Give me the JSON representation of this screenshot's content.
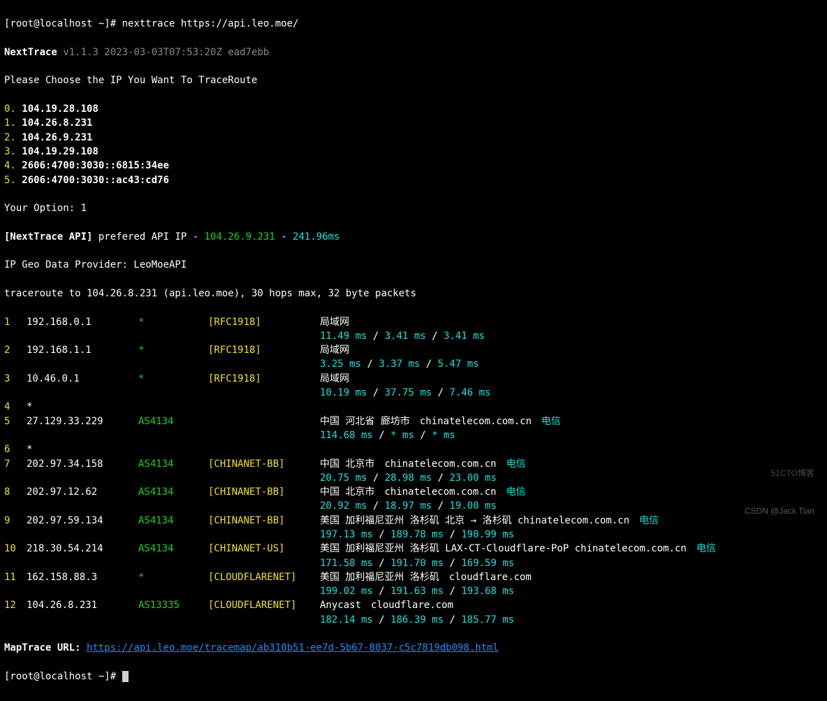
{
  "prompt1_user": "[root@localhost ~]#",
  "cmd": "nexttrace https://api.leo.moe/",
  "app_name": "NextTrace",
  "version": "v1.1.3 2023-03-03T07:53:20Z ead7ebb",
  "choose_msg": "Please Choose the IP You Want To TraceRoute",
  "ip_options": [
    {
      "idx": "0.",
      "ip": "104.19.28.108"
    },
    {
      "idx": "1.",
      "ip": "104.26.8.231"
    },
    {
      "idx": "2.",
      "ip": "104.26.9.231"
    },
    {
      "idx": "3.",
      "ip": "104.19.29.108"
    },
    {
      "idx": "4.",
      "ip": "2606:4700:3030::6815:34ee"
    },
    {
      "idx": "5.",
      "ip": "2606:4700:3030::ac43:cd76"
    }
  ],
  "your_option": "Your Option: ",
  "option_val": "1",
  "api_label": "[NextTrace API]",
  "api_msg": " prefered API IP - ",
  "api_ip": "104.26.9.231",
  "api_sep": " - ",
  "api_ms": "241.96ms",
  "geo_line": "IP Geo Data Provider: LeoMoeAPI",
  "tr_line": "traceroute to 104.26.8.231 (api.leo.moe), 30 hops max, 32 byte packets",
  "hops": [
    {
      "n": "1",
      "ip": "192.168.0.1",
      "as": "*",
      "tag": "[RFC1918]",
      "loc": "局域网",
      "t": [
        "11.49 ms",
        "3.41 ms",
        "3.41 ms"
      ]
    },
    {
      "n": "2",
      "ip": "192.168.1.1",
      "as": "*",
      "tag": "[RFC1918]",
      "loc": "局域网",
      "t": [
        "3.25 ms",
        "3.37 ms",
        "5.47 ms"
      ]
    },
    {
      "n": "3",
      "ip": "10.46.0.1",
      "as": "*",
      "tag": "[RFC1918]",
      "loc": "局域网",
      "t": [
        "10.19 ms",
        "37.75 ms",
        "7.46 ms"
      ]
    },
    {
      "n": "4",
      "ip": "*"
    },
    {
      "n": "5",
      "ip": "27.129.33.229",
      "as": "AS4134",
      "tag": "",
      "loc": "中国 河北省 廊坊市",
      "dom": "chinatelecom.com.cn",
      "isp": "电信",
      "t": [
        "114.68 ms",
        "* ms",
        "* ms"
      ]
    },
    {
      "n": "6",
      "ip": "*"
    },
    {
      "n": "7",
      "ip": "202.97.34.158",
      "as": "AS4134",
      "tag": "[CHINANET-BB]",
      "loc": "中国 北京市",
      "dom": "chinatelecom.com.cn",
      "isp": "电信",
      "t": [
        "20.75 ms",
        "28.98 ms",
        "23.00 ms"
      ]
    },
    {
      "n": "8",
      "ip": "202.97.12.62",
      "as": "AS4134",
      "tag": "[CHINANET-BB]",
      "loc": "中国 北京市",
      "dom": "chinatelecom.com.cn",
      "isp": "电信",
      "t": [
        "20.92 ms",
        "18.97 ms",
        "19.00 ms"
      ]
    },
    {
      "n": "9",
      "ip": "202.97.59.134",
      "as": "AS4134",
      "tag": "[CHINANET-BB]",
      "loc": "美国 加利福尼亚州 洛杉矶 北京 → 洛杉矶 chinatelecom.com.cn",
      "isp": "电信",
      "t": [
        "197.13 ms",
        "189.78 ms",
        "190.99 ms"
      ]
    },
    {
      "n": "10",
      "ip": "218.30.54.214",
      "as": "AS4134",
      "tag": "[CHINANET-US]",
      "loc": "美国 加利福尼亚州 洛杉矶 LAX-CT-Cloudflare-PoP chinatelecom.com.cn",
      "isp": "电信",
      "t": [
        "171.58 ms",
        "191.70 ms",
        "169.59 ms"
      ]
    },
    {
      "n": "11",
      "ip": "162.158.88.3",
      "as": "*",
      "tag": "[CLOUDFLARENET]",
      "loc": "美国 加利福尼亚州 洛杉矶",
      "dom": "cloudflare.com",
      "t": [
        "199.02 ms",
        "191.63 ms",
        "193.68 ms"
      ]
    },
    {
      "n": "12",
      "ip": "104.26.8.231",
      "as": "AS13335",
      "tag": "[CLOUDFLARENET]",
      "loc": "Anycast",
      "dom": "cloudflare.com",
      "t": [
        "182.14 ms",
        "186.39 ms",
        "185.77 ms"
      ]
    }
  ],
  "maptrace_label": "MapTrace URL: ",
  "maptrace_url": "https://api.leo.moe/tracemap/ab310b51-ee7d-5b67-8037-c5c7819db098.html",
  "prompt2_user": "[root@localhost ~]#",
  "watermark": "CSDN @Jack Tian",
  "watermark2": "51CTO博客"
}
